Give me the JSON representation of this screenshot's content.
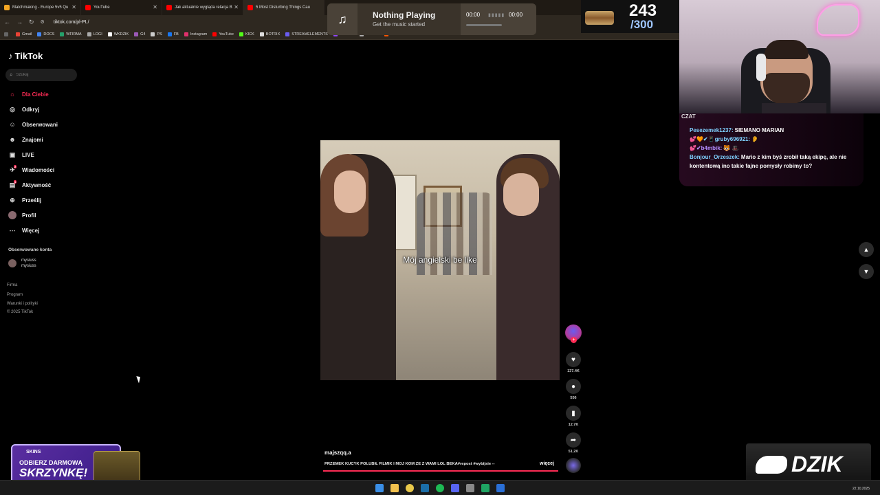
{
  "browser": {
    "tabs": [
      {
        "title": "Matchmaking - Europe 5v5 Qu",
        "color": "#f5a623"
      },
      {
        "title": "YouTube",
        "color": "#ff0000"
      },
      {
        "title": "Jak aktualnie wygląda relacja B",
        "color": "#ff0000"
      },
      {
        "title": "5 Most Disturbing Things Cau",
        "color": "#ff0000"
      }
    ],
    "url": "tiktok.com/pl-PL/",
    "bookmarks": [
      "Gmail",
      "DOCS",
      "WFIRMA",
      "LOGI",
      "WKDZIK",
      "G4",
      "PS",
      "FB",
      "Instagram",
      "YouTube",
      "KICK",
      "BOTRIX",
      "STREAMELEMENTS",
      "TWITCH",
      "TIPPLY",
      "FACEIT",
      "TIKTOK",
      "TikTok PL"
    ]
  },
  "music_widget": {
    "title": "Nothing Playing",
    "subtitle": "Get the music started",
    "time_current": "00:00",
    "time_total": "00:00"
  },
  "counter": {
    "value": "243",
    "max": "/300"
  },
  "chat": {
    "header": "CZAT",
    "messages": [
      {
        "user": "Pesezemek1237:",
        "text": "SIEMANO MARIAN",
        "user_color": "#7fd1ff"
      },
      {
        "user": "💕🧡✔📱gruby696921:",
        "text": "👂",
        "user_color": "#7fd1ff"
      },
      {
        "user": "💕✔b4mbik:",
        "text": "🐯 🎩",
        "user_color": "#b48cff"
      },
      {
        "user": "Bonjour_Orzeszek:",
        "text": "Mario z kim byś zrobił taką ekipę, ale nie kontentową ino takie fajne pomysły robimy to?",
        "user_color": "#7fd1ff"
      }
    ]
  },
  "tiktok": {
    "logo": "TikTok",
    "search_placeholder": "Szukaj",
    "nav": [
      {
        "label": "Dla Ciebie",
        "icon": "home-icon",
        "glyph": "⌂"
      },
      {
        "label": "Odkryj",
        "icon": "compass-icon",
        "glyph": "◎"
      },
      {
        "label": "Obserwowani",
        "icon": "user-icon",
        "glyph": "☺"
      },
      {
        "label": "Znajomi",
        "icon": "friends-icon",
        "glyph": "☻"
      },
      {
        "label": "LIVE",
        "icon": "live-icon",
        "glyph": "▣"
      },
      {
        "label": "Wiadomości",
        "icon": "messages-icon",
        "glyph": "✈",
        "badge": "2"
      },
      {
        "label": "Aktywność",
        "icon": "activity-icon",
        "glyph": "▤",
        "badge": "1"
      },
      {
        "label": "Prześlij",
        "icon": "upload-icon",
        "glyph": "⊕"
      },
      {
        "label": "Profil",
        "icon": "profile-avatar",
        "glyph": ""
      },
      {
        "label": "Więcej",
        "icon": "more-icon",
        "glyph": "⋯"
      }
    ],
    "followed_header": "Obserwowane konta",
    "followed_account": {
      "name": "mysiuss",
      "handle": "mysiuss"
    },
    "footer": [
      "Firma",
      "Program",
      "Warunki i polityki",
      "© 2025 TikTok"
    ],
    "video": {
      "caption": "Mój angielski be like",
      "author": "majszqq.a",
      "description": "PRZEMEK KUCYK POLUBIŁ FILMIK I MÓJ KOM ŻE Z WAMI LOL BEKA#repost #wybijsie --",
      "more": "więcej",
      "likes": "137.4K",
      "comments": "556",
      "saves": "12.7K",
      "shares": "51.2K"
    }
  },
  "promo": {
    "brand": "SKINS",
    "line1": "ODBIERZ DARMOWĄ",
    "line2": "SKRZYNKĘ!"
  },
  "sponsor": {
    "text": "DZIK"
  },
  "taskbar": {
    "date": "22.10.2025"
  }
}
